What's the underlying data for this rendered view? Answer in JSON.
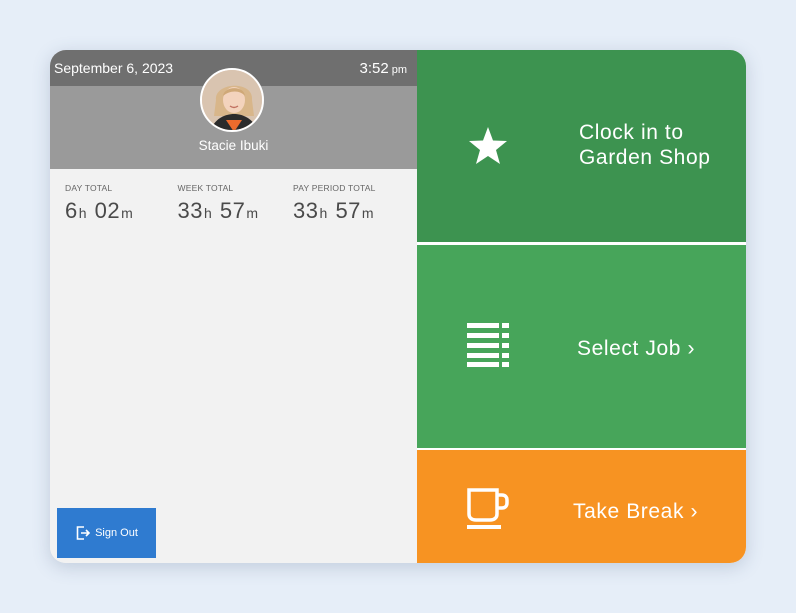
{
  "header": {
    "date": "September 6, 2023",
    "time": "3:52",
    "ampm": "pm"
  },
  "user": {
    "name": "Stacie Ibuki"
  },
  "totals": [
    {
      "label": "DAY TOTAL",
      "hours": "6",
      "minutes": "02"
    },
    {
      "label": "WEEK TOTAL",
      "hours": "33",
      "minutes": "57"
    },
    {
      "label": "PAY PERIOD TOTAL",
      "hours": "33",
      "minutes": "57"
    }
  ],
  "units": {
    "h": "h",
    "m": "m"
  },
  "signout": {
    "label": "Sign Out"
  },
  "actions": {
    "clock_in": {
      "label": "Clock in to Garden Shop",
      "icon": "star-icon"
    },
    "select_job": {
      "label": "Select Job ›",
      "icon": "list-icon"
    },
    "take_break": {
      "label": "Take Break ›",
      "icon": "coffee-cup-icon"
    }
  },
  "colors": {
    "clock_in_bg": "#3d9350",
    "select_job_bg": "#47a55a",
    "take_break_bg": "#f79322",
    "signout_bg": "#2f7bd0",
    "topbar_bg": "#6f6f6f",
    "profile_bg": "#9a9a9a"
  }
}
